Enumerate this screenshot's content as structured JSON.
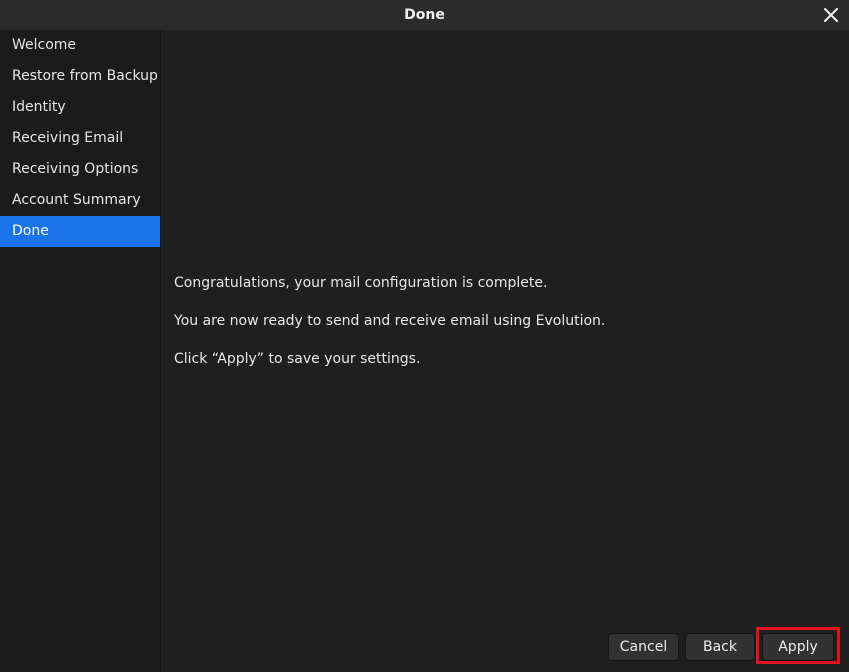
{
  "window": {
    "title": "Done"
  },
  "sidebar": {
    "items": [
      {
        "label": "Welcome"
      },
      {
        "label": "Restore from Backup"
      },
      {
        "label": "Identity"
      },
      {
        "label": "Receiving Email"
      },
      {
        "label": "Receiving Options"
      },
      {
        "label": "Account Summary"
      },
      {
        "label": "Done"
      }
    ],
    "active_index": 6
  },
  "main": {
    "lines": [
      "Congratulations, your mail configuration is complete.",
      "You are now ready to send and receive email using Evolution.",
      "Click “Apply” to save your settings."
    ]
  },
  "buttons": {
    "cancel": "Cancel",
    "back": "Back",
    "apply": "Apply"
  },
  "colors": {
    "accent": "#1a73e8",
    "highlight": "#e3101d",
    "background": "#1f1f1f"
  },
  "icons": {
    "close": "close-icon"
  }
}
